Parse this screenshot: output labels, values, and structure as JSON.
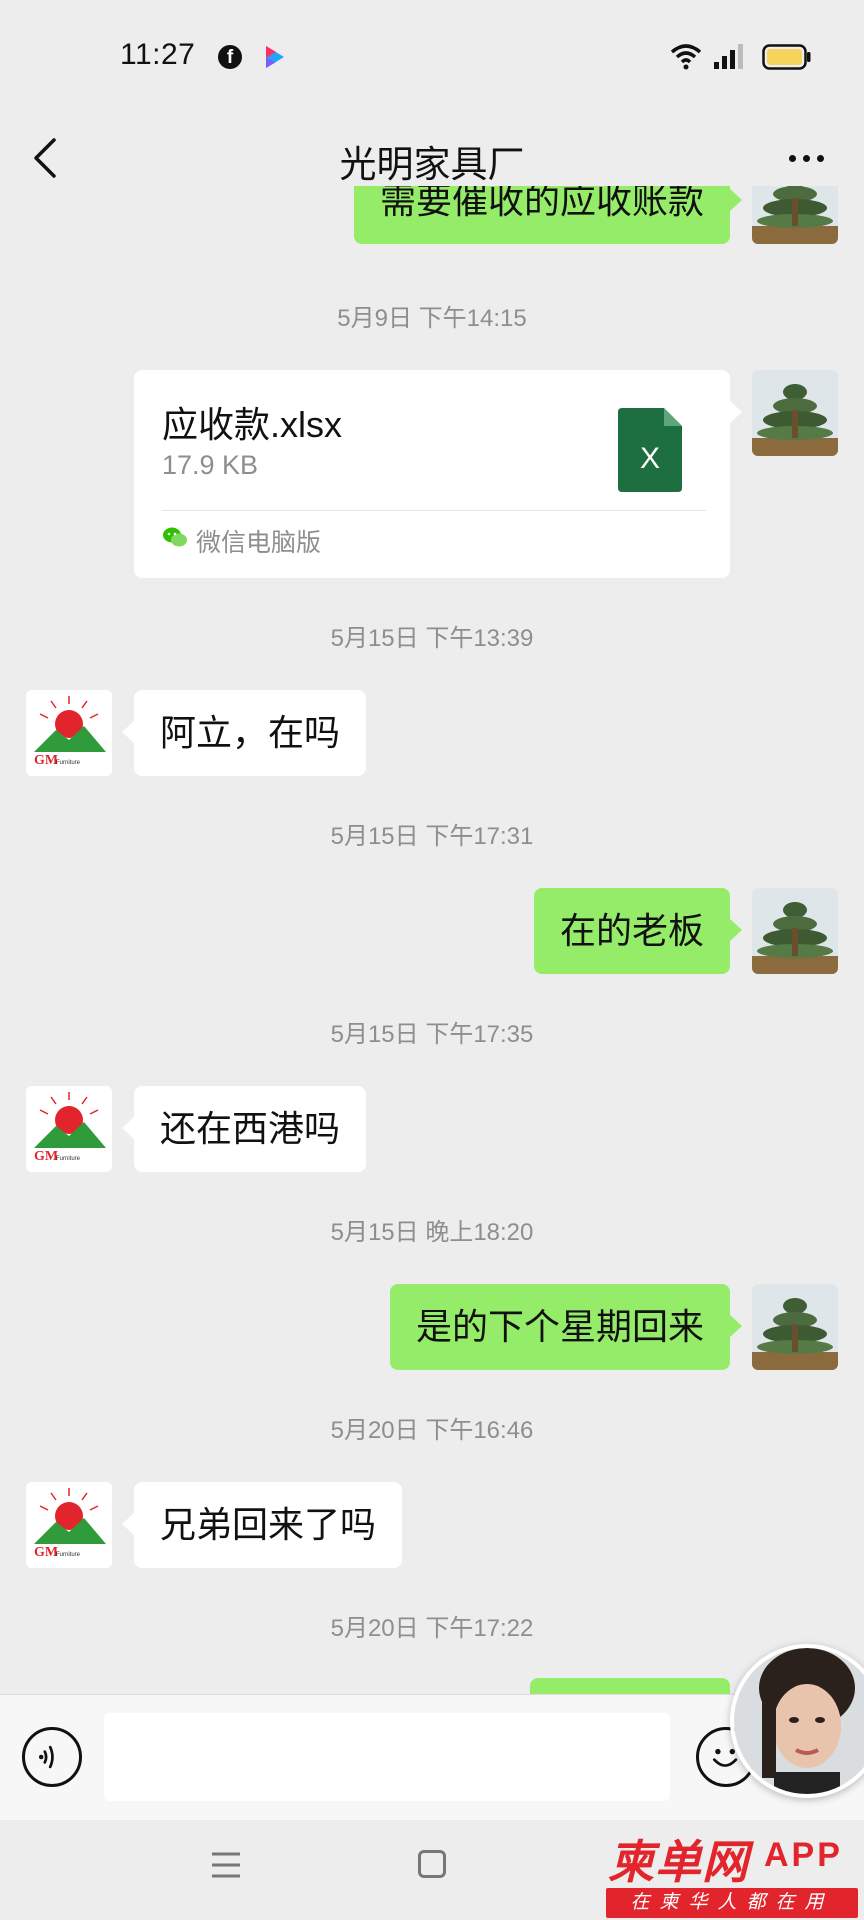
{
  "status_bar": {
    "time": "11:27",
    "app_icons": [
      "facebook-icon",
      "youku-icon"
    ],
    "system_icons": [
      "wifi-icon",
      "signal-icon",
      "battery-icon"
    ]
  },
  "nav": {
    "title": "光明家具厂",
    "back_icon": "chevron-left-icon",
    "more_icon": "more-dots-icon"
  },
  "messages": [
    {
      "type": "text",
      "sender": "me",
      "text": "需要催收的应收账款"
    },
    {
      "type": "timestamp",
      "text": "5月9日 下午14:15"
    },
    {
      "type": "file",
      "sender": "me",
      "file_name": "应收款.xlsx",
      "file_size": "17.9 KB",
      "source": "微信电脑版",
      "file_icon": "excel-icon"
    },
    {
      "type": "timestamp",
      "text": "5月15日 下午13:39"
    },
    {
      "type": "text",
      "sender": "them",
      "text": "阿立，在吗"
    },
    {
      "type": "timestamp",
      "text": "5月15日 下午17:31"
    },
    {
      "type": "text",
      "sender": "me",
      "text": "在的老板"
    },
    {
      "type": "timestamp",
      "text": "5月15日 下午17:35"
    },
    {
      "type": "text",
      "sender": "them",
      "text": "还在西港吗"
    },
    {
      "type": "timestamp",
      "text": "5月15日 晚上18:20"
    },
    {
      "type": "text",
      "sender": "me",
      "text": "是的下个星期回来"
    },
    {
      "type": "timestamp",
      "text": "5月20日 下午16:46"
    },
    {
      "type": "text",
      "sender": "them",
      "text": "兄弟回来了吗"
    },
    {
      "type": "timestamp",
      "text": "5月20日 下午17:22"
    }
  ],
  "avatars": {
    "me": "bonsai-tree-avatar",
    "them": "gm-furniture-logo-avatar",
    "them_logo_text": "GM"
  },
  "input_bar": {
    "voice_icon": "voice-icon",
    "emoji_icon": "emoji-icon",
    "input_value": ""
  },
  "system_nav": {
    "icons": [
      "menu-key-icon",
      "home-key-icon"
    ]
  },
  "watermark": {
    "brand": "柬单网",
    "app": "APP",
    "slogan": "在柬华人都在用"
  },
  "colors": {
    "background": "#ededed",
    "my_bubble": "#95ec69",
    "their_bubble": "#ffffff",
    "timestamp_text": "#8e8e8e",
    "excel_green": "#1d6f42",
    "watermark_red": "#e2242c"
  }
}
